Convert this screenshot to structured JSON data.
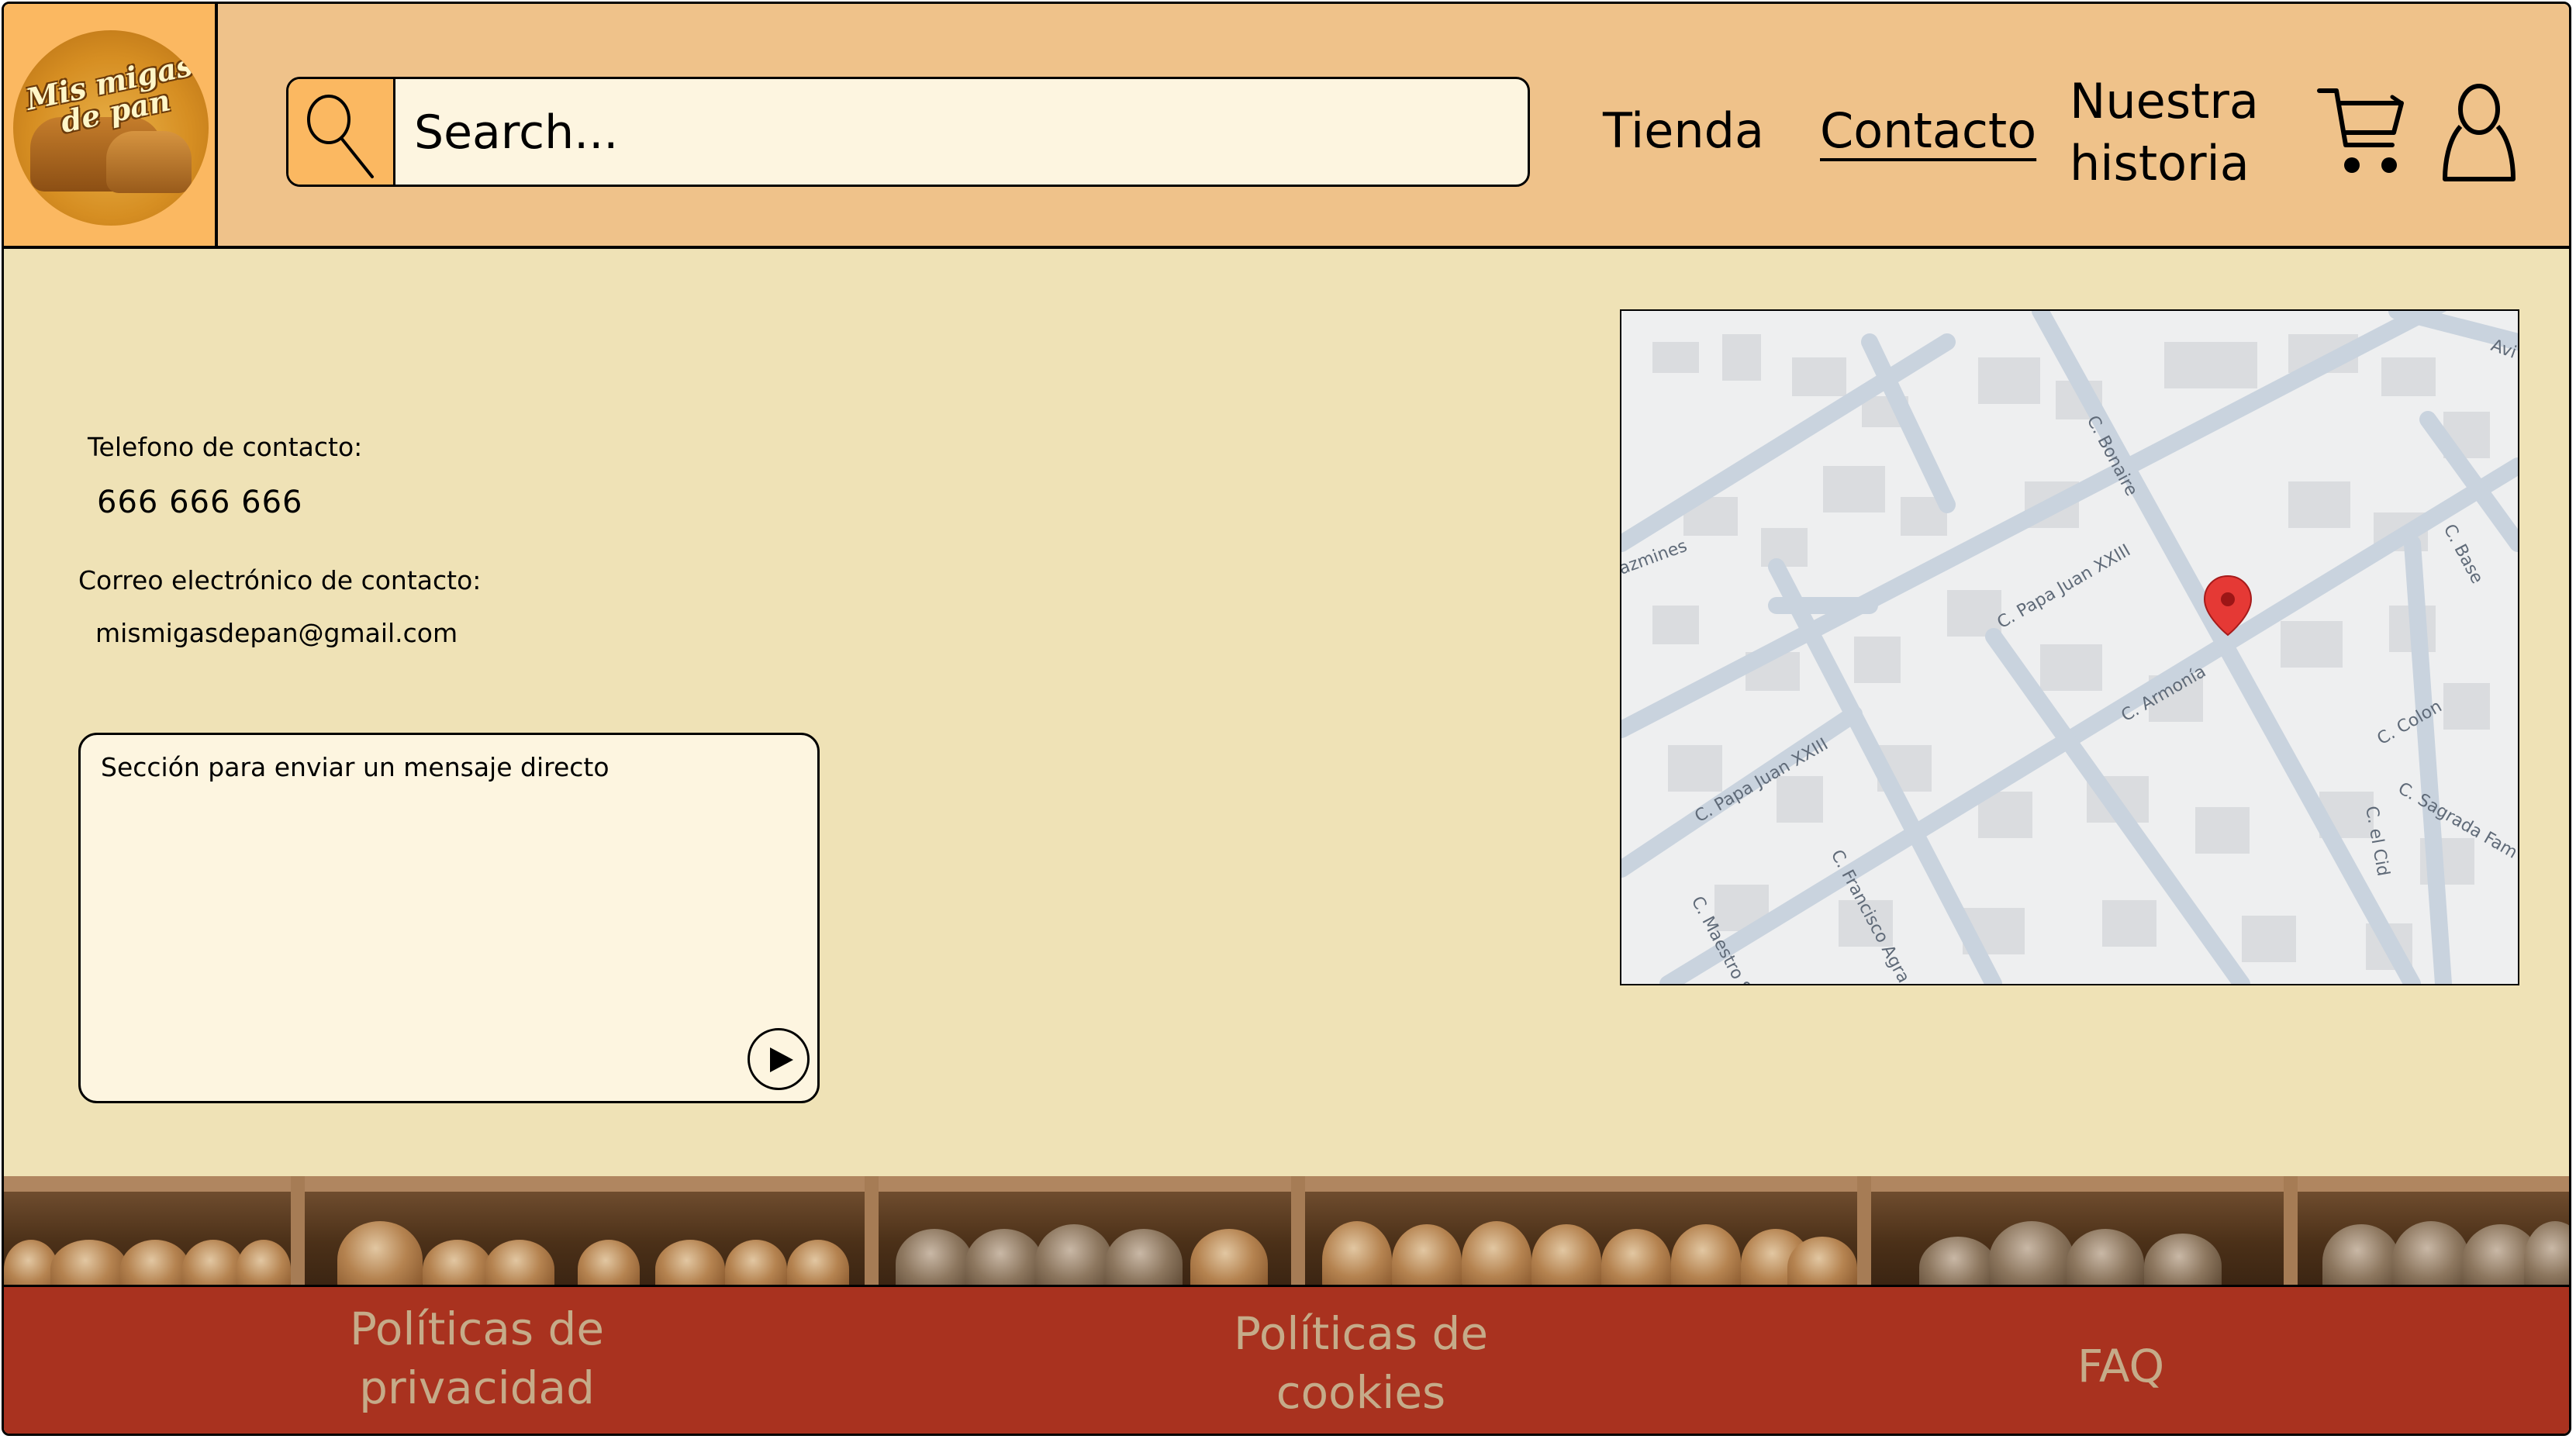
{
  "header": {
    "logo_text": "Mis migas de pan",
    "search_placeholder": "Search...",
    "nav": {
      "tienda": "Tienda",
      "contacto": "Contacto",
      "historia_line1": "Nuestra",
      "historia_line2": "historia"
    },
    "icons": [
      "search-icon",
      "cart-icon",
      "user-icon"
    ]
  },
  "contact": {
    "phone_label": "Telefono de contacto:",
    "phone_value": "666 666 666",
    "email_label": "Correo electrónico de contacto:",
    "email_value": "mismigasdepan@gmail.com",
    "message_placeholder": "Sección para enviar un mensaje directo"
  },
  "map": {
    "streets": [
      "C. Bonaire",
      "C. Papa Juan XXIII",
      "C. Papa Juan XXIII",
      "C. Armonía",
      "C. Base",
      "C. Colon",
      "C. Sagrada Fam",
      "C. el Cid",
      "C. Francisco Agra",
      "C. Maestro Ser",
      "azmines",
      "Avi"
    ],
    "pin_color": "#e53935"
  },
  "footer": {
    "privacy_line1": "Políticas de",
    "privacy_line2": "privacidad",
    "cookies_line1": "Políticas de",
    "cookies_line2": "cookies",
    "faq": "FAQ"
  },
  "colors": {
    "header_bg": "#efc28a",
    "logo_bg": "#fbb861",
    "page_bg": "#efe2b6",
    "footer_bg": "#a9321f",
    "footer_text": "#c5ab89"
  }
}
